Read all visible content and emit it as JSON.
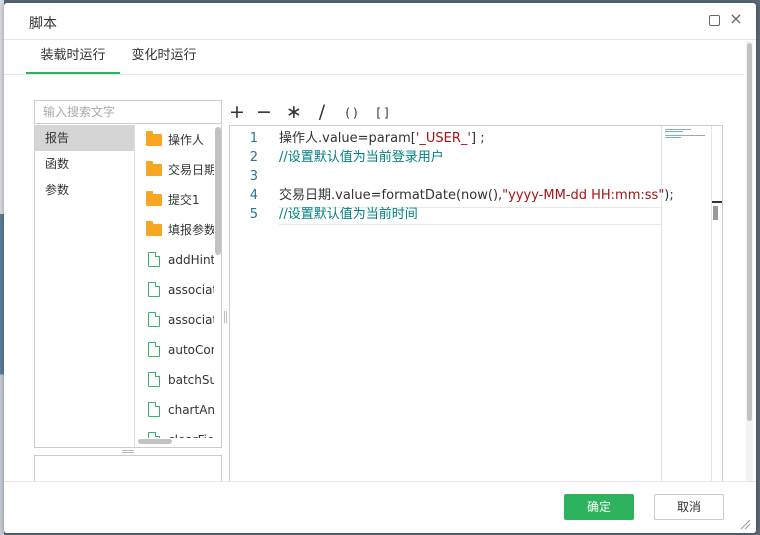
{
  "dialog": {
    "title": "脚本",
    "maximize_icon": "maximize-icon",
    "close_icon": "×"
  },
  "tabs": [
    {
      "label": "装载时运行",
      "active": true
    },
    {
      "label": "变化时运行",
      "active": false
    }
  ],
  "search": {
    "placeholder": "输入搜索文字"
  },
  "categories": [
    {
      "label": "报告",
      "selected": true
    },
    {
      "label": "函数",
      "selected": false
    },
    {
      "label": "参数",
      "selected": false
    }
  ],
  "functions": [
    {
      "label": "操作人",
      "icon": "folder-icon"
    },
    {
      "label": "交易日期",
      "icon": "folder-icon"
    },
    {
      "label": "提交1",
      "icon": "folder-icon"
    },
    {
      "label": "填报参数",
      "icon": "folder-icon"
    },
    {
      "label": "addHint(",
      "icon": "file-icon"
    },
    {
      "label": "associat",
      "icon": "file-icon"
    },
    {
      "label": "associat",
      "icon": "file-icon"
    },
    {
      "label": "autoCom",
      "icon": "file-icon"
    },
    {
      "label": "batchSu",
      "icon": "file-icon"
    },
    {
      "label": "chartAni",
      "icon": "file-icon"
    },
    {
      "label": "clearFiel",
      "icon": "file-icon"
    }
  ],
  "operators": [
    "+",
    "−",
    "∗",
    "/",
    "()",
    "[]"
  ],
  "editor": {
    "lines": [
      {
        "num": "1",
        "parts": [
          {
            "t": "操作人.value=param[",
            "c": ""
          },
          {
            "t": "'_USER_'",
            "c": "str"
          },
          {
            "t": "] ;",
            "c": ""
          }
        ]
      },
      {
        "num": "2",
        "parts": [
          {
            "t": "//设置默认值为当前登录用户",
            "c": "comment"
          }
        ]
      },
      {
        "num": "3",
        "parts": []
      },
      {
        "num": "4",
        "parts": [
          {
            "t": "交易日期.value=formatDate(now(),",
            "c": ""
          },
          {
            "t": "\"yyyy-MM-dd HH:mm:ss\"",
            "c": "str"
          },
          {
            "t": ");",
            "c": ""
          }
        ]
      },
      {
        "num": "5",
        "parts": [
          {
            "t": "//设置默认值为当前时间",
            "c": "comment"
          }
        ]
      }
    ]
  },
  "footer": {
    "ok_label": "确定",
    "cancel_label": "取消"
  },
  "colors": {
    "accent": "#2db35d",
    "string": "#a31515",
    "comment": "#008080",
    "line_number": "#237893"
  }
}
